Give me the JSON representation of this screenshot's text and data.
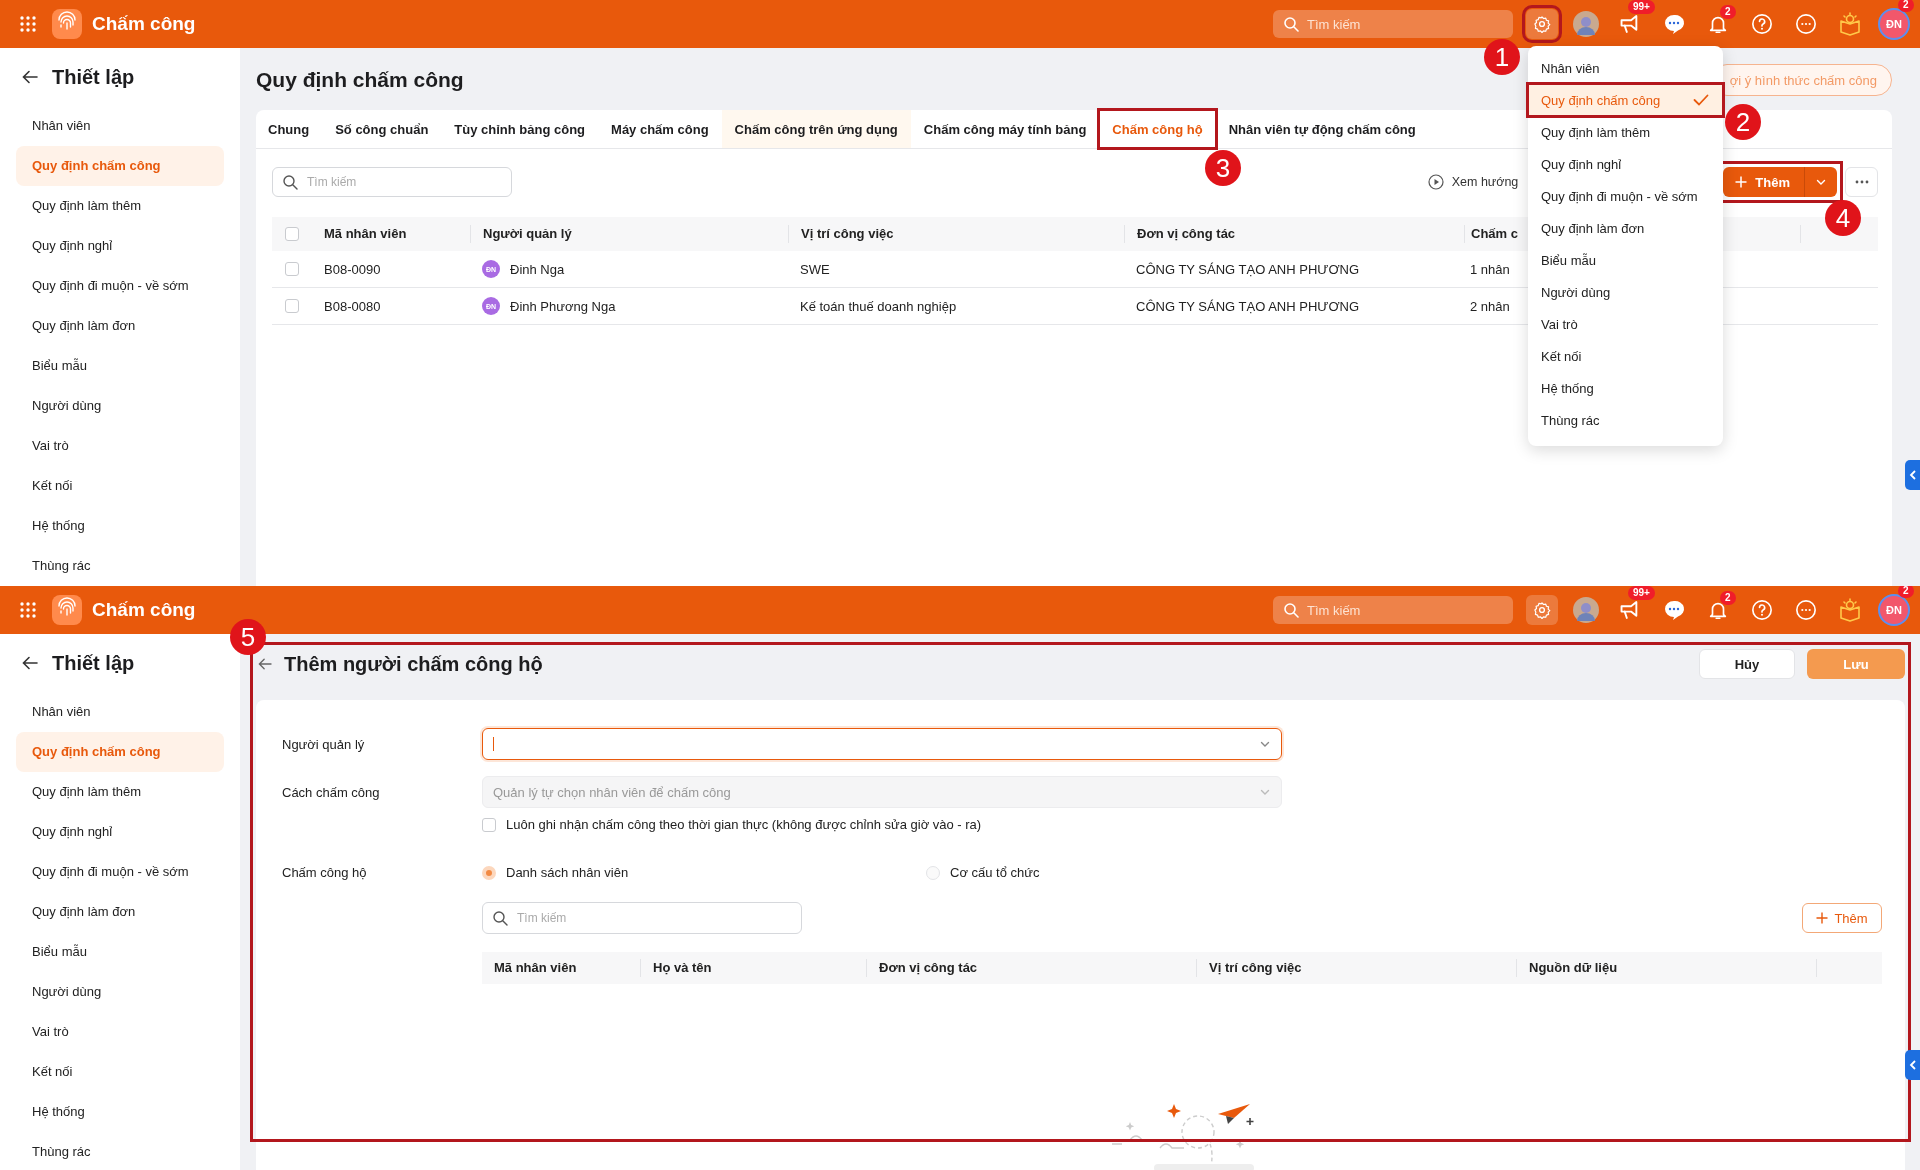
{
  "settings_screen": {
    "header": {
      "app_title": "Chấm công",
      "search_placeholder": "Tìm kiếm",
      "feedback_badge": "99+",
      "notification_badge": "2",
      "profile_initials": "ĐN",
      "profile_badge": "2"
    },
    "sidebar": {
      "title": "Thiết lập",
      "items": [
        {
          "label": "Nhân viên",
          "selected": false
        },
        {
          "label": "Quy định chấm công",
          "selected": true
        },
        {
          "label": "Quy định làm thêm",
          "selected": false
        },
        {
          "label": "Quy định nghỉ",
          "selected": false
        },
        {
          "label": "Quy định đi muộn - về sớm",
          "selected": false
        },
        {
          "label": "Quy định làm đơn",
          "selected": false
        },
        {
          "label": "Biểu mẫu",
          "selected": false
        },
        {
          "label": "Người dùng",
          "selected": false
        },
        {
          "label": "Vai trò",
          "selected": false
        },
        {
          "label": "Kết nối",
          "selected": false
        },
        {
          "label": "Hệ thống",
          "selected": false
        },
        {
          "label": "Thùng rác",
          "selected": false
        }
      ]
    },
    "page": {
      "title": "Quy định chấm công",
      "suggest_button": "ợi ý hình thức chấm công",
      "tabs": [
        {
          "label": "Chung",
          "selected": false,
          "hovered": false
        },
        {
          "label": "Số công chuẩn",
          "selected": false,
          "hovered": false
        },
        {
          "label": "Tùy chỉnh bảng công",
          "selected": false,
          "hovered": false
        },
        {
          "label": "Máy chấm công",
          "selected": false,
          "hovered": false
        },
        {
          "label": "Chấm công trên ứng dụng",
          "selected": false,
          "hovered": true
        },
        {
          "label": "Chấm công máy tính bảng",
          "selected": false,
          "hovered": false
        },
        {
          "label": "Chấm công hộ",
          "selected": true,
          "hovered": false
        },
        {
          "label": "Nhân viên tự động chấm công",
          "selected": false,
          "hovered": false
        }
      ],
      "search_placeholder": "Tìm kiếm",
      "guide_link": "Xem hướng",
      "add_button": "Thêm",
      "table": {
        "all_checked": false,
        "columns": [
          "Mã nhân viên",
          "Người quản lý",
          "Vị trí công việc",
          "Đơn vị công tác",
          "Chấm c"
        ],
        "rows": [
          {
            "checked": false,
            "employee_id": "B08-0090",
            "manager_initials": "ĐN",
            "manager": "Đinh Nga",
            "position": "SWE",
            "unit": "CÔNG TY SÁNG TẠO ANH PHƯƠNG",
            "column_5": "1 nhân"
          },
          {
            "checked": false,
            "employee_id": "B08-0080",
            "manager_initials": "ĐN",
            "manager": "Đinh Phương Nga",
            "position": "Kế toán thuế doanh nghiệp",
            "unit": "CÔNG TY SÁNG TẠO ANH PHƯƠNG",
            "column_5": "2 nhân"
          }
        ]
      }
    },
    "settings_menu": {
      "items": [
        {
          "label": "Nhân viên",
          "selected": false
        },
        {
          "label": "Quy định chấm công",
          "selected": true
        },
        {
          "label": "Quy định làm thêm",
          "selected": false
        },
        {
          "label": "Quy định nghỉ",
          "selected": false
        },
        {
          "label": "Quy định đi muộn - về sớm",
          "selected": false
        },
        {
          "label": "Quy định làm đơn",
          "selected": false
        },
        {
          "label": "Biểu mẫu",
          "selected": false
        },
        {
          "label": "Người dùng",
          "selected": false
        },
        {
          "label": "Vai trò",
          "selected": false
        },
        {
          "label": "Kết nối",
          "selected": false
        },
        {
          "label": "Hệ thống",
          "selected": false
        },
        {
          "label": "Thùng rác",
          "selected": false
        }
      ]
    },
    "markers": [
      "1",
      "2",
      "3",
      "4"
    ]
  },
  "add_form_screen": {
    "header": {
      "app_title": "Chấm công",
      "search_placeholder": "Tìm kiếm",
      "feedback_badge": "99+",
      "notification_badge": "2",
      "profile_initials": "ĐN",
      "profile_badge": "2"
    },
    "sidebar": {
      "title": "Thiết lập",
      "items": [
        {
          "label": "Nhân viên",
          "selected": false
        },
        {
          "label": "Quy định chấm công",
          "selected": true
        },
        {
          "label": "Quy định làm thêm",
          "selected": false
        },
        {
          "label": "Quy định nghỉ",
          "selected": false
        },
        {
          "label": "Quy định đi muộn - về sớm",
          "selected": false
        },
        {
          "label": "Quy định làm đơn",
          "selected": false
        },
        {
          "label": "Biểu mẫu",
          "selected": false
        },
        {
          "label": "Người dùng",
          "selected": false
        },
        {
          "label": "Vai trò",
          "selected": false
        },
        {
          "label": "Kết nối",
          "selected": false
        },
        {
          "label": "Hệ thống",
          "selected": false
        },
        {
          "label": "Thùng rác",
          "selected": false
        }
      ]
    },
    "form": {
      "title": "Thêm người chấm công hộ",
      "cancel_button": "Hủy",
      "save_button": "Lưu",
      "manager_field": {
        "label": "Người quản lý",
        "focused": true
      },
      "method_field": {
        "label": "Cách chấm công",
        "value": "Quản lý tự chọn nhân viên để chấm công",
        "disabled": true
      },
      "realtime_checkbox": {
        "label": "Luôn ghi nhận chấm công theo thời gian thực (không được chỉnh sửa giờ vào - ra)",
        "checked": false
      },
      "proxy_group": {
        "label": "Chấm công hộ",
        "options": [
          {
            "label": "Danh sách nhân viên",
            "selected": true
          },
          {
            "label": "Cơ cấu tổ chức",
            "selected": false
          }
        ]
      },
      "search_placeholder": "Tìm kiếm",
      "add_button": "Thêm",
      "table": {
        "columns": [
          "Mã nhân viên",
          "Họ và tên",
          "Đơn vị công tác",
          "Vị trí công việc",
          "Nguồn dữ liệu"
        ]
      }
    },
    "markers": [
      "5"
    ]
  }
}
